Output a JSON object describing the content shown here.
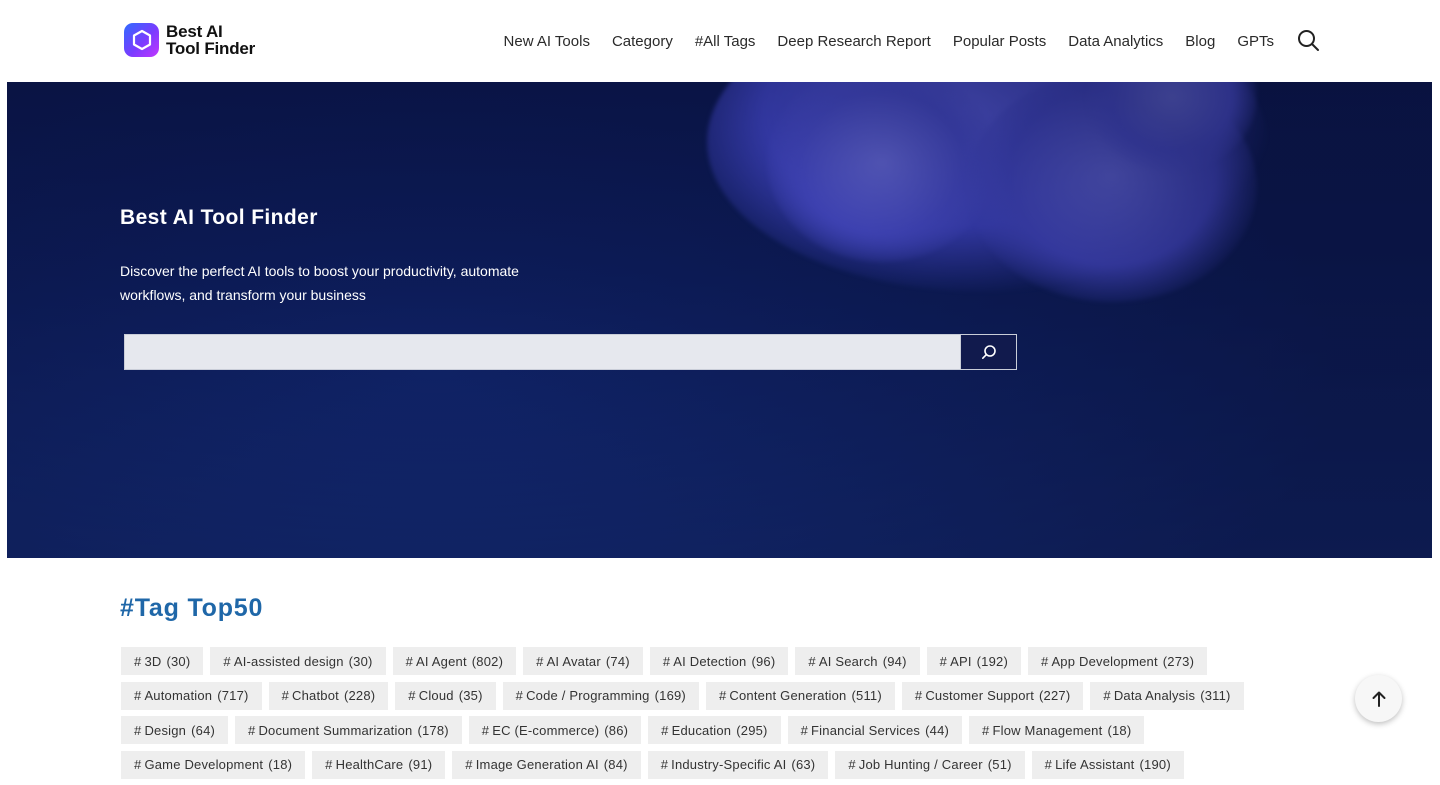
{
  "brand": {
    "line1": "Best AI",
    "line2": "Tool Finder",
    "logo_icon": "hexagon-logo-icon",
    "gradient_colors": [
      "#2f6bff",
      "#7a3cff",
      "#c236ff"
    ]
  },
  "nav": {
    "items": [
      {
        "label": "New AI Tools"
      },
      {
        "label": "Category"
      },
      {
        "label": "#All Tags"
      },
      {
        "label": "Deep Research Report"
      },
      {
        "label": "Popular Posts"
      },
      {
        "label": "Data Analytics"
      },
      {
        "label": "Blog"
      },
      {
        "label": "GPTs"
      }
    ],
    "search_icon": "search-icon"
  },
  "hero": {
    "title": "Best AI Tool Finder",
    "description": "Discover the perfect AI tools to boost your productivity, automate workflows, and transform your business",
    "search": {
      "value": "",
      "placeholder": "",
      "button_icon": "search-icon"
    },
    "background_color": "#0d1d5c",
    "blob_color": "#5a5cf0"
  },
  "tags_section": {
    "title": "#Tag Top50",
    "title_color": "#1f67a8",
    "rows": [
      [
        {
          "name": "3D",
          "count": "(30)"
        },
        {
          "name": "AI-assisted design",
          "count": "(30)"
        },
        {
          "name": "AI Agent",
          "count": "(802)"
        },
        {
          "name": "AI Avatar",
          "count": "(74)"
        },
        {
          "name": "AI Detection",
          "count": "(96)"
        },
        {
          "name": "AI Search",
          "count": "(94)"
        },
        {
          "name": "API",
          "count": "(192)"
        },
        {
          "name": "App Development",
          "count": "(273)"
        }
      ],
      [
        {
          "name": "Automation",
          "count": "(717)"
        },
        {
          "name": "Chatbot",
          "count": "(228)"
        },
        {
          "name": "Cloud",
          "count": "(35)"
        },
        {
          "name": "Code / Programming",
          "count": "(169)"
        },
        {
          "name": "Content Generation",
          "count": "(511)"
        },
        {
          "name": "Customer Support",
          "count": "(227)"
        },
        {
          "name": "Data Analysis",
          "count": "(311)"
        }
      ],
      [
        {
          "name": "Design",
          "count": "(64)"
        },
        {
          "name": "Document Summarization",
          "count": "(178)"
        },
        {
          "name": "EC (E-commerce)",
          "count": "(86)"
        },
        {
          "name": "Education",
          "count": "(295)"
        },
        {
          "name": "Financial Services",
          "count": "(44)"
        },
        {
          "name": "Flow Management",
          "count": "(18)"
        }
      ],
      [
        {
          "name": "Game Development",
          "count": "(18)"
        },
        {
          "name": "HealthCare",
          "count": "(91)"
        },
        {
          "name": "Image Generation AI",
          "count": "(84)"
        },
        {
          "name": "Industry-Specific AI",
          "count": "(63)"
        },
        {
          "name": "Job Hunting / Career",
          "count": "(51)"
        },
        {
          "name": "Life Assistant",
          "count": "(190)"
        }
      ]
    ]
  },
  "back_to_top": {
    "icon": "arrow-up-icon"
  }
}
